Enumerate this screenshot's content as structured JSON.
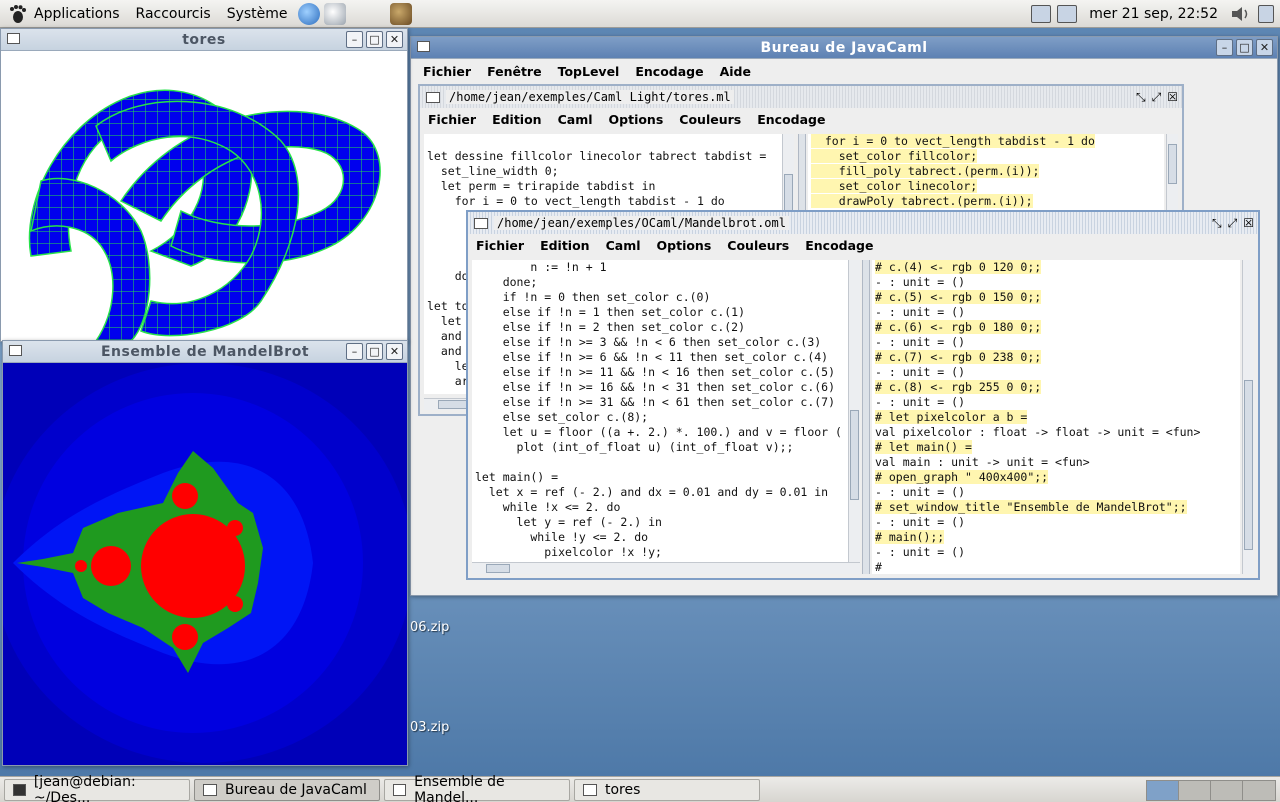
{
  "top_panel": {
    "applications": "Applications",
    "shortcuts": "Raccourcis",
    "system": "Système",
    "clock": "mer 21 sep, 22:52"
  },
  "desktop": {
    "files": [
      "06.zip",
      "03.zip"
    ]
  },
  "tores_window": {
    "title": "tores"
  },
  "mandelbrot_window": {
    "title": "Ensemble de MandelBrot"
  },
  "javacaml_window": {
    "title": "Bureau de JavaCaml",
    "menu": [
      "Fichier",
      "Fenêtre",
      "TopLevel",
      "Encodage",
      "Aide"
    ]
  },
  "tores_frame": {
    "path": "/home/jean/exemples/Caml Light/tores.ml",
    "menu": [
      "Fichier",
      "Edition",
      "Caml",
      "Options",
      "Couleurs",
      "Encodage"
    ],
    "code": [
      "",
      "let dessine fillcolor linecolor tabrect tabdist =",
      "  set_line_width 0;",
      "  let perm = trirapide tabdist in",
      "    for i = 0 to vect_length tabdist - 1 do",
      "",
      "",
      "",
      "",
      "    do",
      "",
      "let to",
      "  let",
      "  and",
      "  and",
      "    le",
      "    ar"
    ],
    "toplevel": [
      "  for i = 0 to vect_length tabdist - 1 do",
      "    set_color fillcolor;",
      "    fill_poly tabrect.(perm.(i));",
      "    set_color linecolor;",
      "    drawPoly tabrect.(perm.(i));"
    ]
  },
  "mandel_frame": {
    "path": "/home/jean/exemples/OCaml/Mandelbrot.oml",
    "menu": [
      "Fichier",
      "Edition",
      "Caml",
      "Options",
      "Couleurs",
      "Encodage"
    ],
    "code": [
      "        n := !n + 1",
      "    done;",
      "    if !n = 0 then set_color c.(0)",
      "    else if !n = 1 then set_color c.(1)",
      "    else if !n = 2 then set_color c.(2)",
      "    else if !n >= 3 && !n < 6 then set_color c.(3)",
      "    else if !n >= 6 && !n < 11 then set_color c.(4)",
      "    else if !n >= 11 && !n < 16 then set_color c.(5)",
      "    else if !n >= 16 && !n < 31 then set_color c.(6)",
      "    else if !n >= 31 && !n < 61 then set_color c.(7)",
      "    else set_color c.(8);",
      "    let u = floor ((a +. 2.) *. 100.) and v = floor (",
      "      plot (int_of_float u) (int_of_float v);;",
      "",
      "let main() =",
      "  let x = ref (- 2.) and dx = 0.01 and dy = 0.01 in",
      "    while !x <= 2. do",
      "      let y = ref (- 2.) in",
      "        while !y <= 2. do",
      "          pixelcolor !x !y;"
    ],
    "toplevel": [
      {
        "t": "# c.(4) <- rgb 0 120 0;;",
        "hl": true
      },
      {
        "t": "- : unit = ()",
        "hl": false
      },
      {
        "t": "# c.(5) <- rgb 0 150 0;;",
        "hl": true
      },
      {
        "t": "- : unit = ()",
        "hl": false
      },
      {
        "t": "# c.(6) <- rgb 0 180 0;;",
        "hl": true
      },
      {
        "t": "- : unit = ()",
        "hl": false
      },
      {
        "t": "# c.(7) <- rgb 0 238 0;;",
        "hl": true
      },
      {
        "t": "- : unit = ()",
        "hl": false
      },
      {
        "t": "# c.(8) <- rgb 255 0 0;;",
        "hl": true
      },
      {
        "t": "- : unit = ()",
        "hl": false
      },
      {
        "t": "# let pixelcolor a b =",
        "hl": true
      },
      {
        "t": "val pixelcolor : float -> float -> unit = <fun>",
        "hl": false
      },
      {
        "t": "# let main() =",
        "hl": true
      },
      {
        "t": "val main : unit -> unit = <fun>",
        "hl": false
      },
      {
        "t": "# open_graph \" 400x400\";;",
        "hl": true
      },
      {
        "t": "- : unit = ()",
        "hl": false
      },
      {
        "t": "# set_window_title \"Ensemble de MandelBrot\";;",
        "hl": true
      },
      {
        "t": "- : unit = ()",
        "hl": false
      },
      {
        "t": "# main();;",
        "hl": true
      },
      {
        "t": "- : unit = ()",
        "hl": false
      },
      {
        "t": "#",
        "hl": false
      }
    ]
  },
  "taskbar": {
    "tasks": [
      "[jean@debian: ~/Des...",
      "Bureau de JavaCaml",
      "Ensemble de Mandel...",
      "tores"
    ]
  },
  "colors": {
    "mandel_red": "#ff0000",
    "mandel_green": "#1f9a1f",
    "torus_blue": "#0000ee",
    "torus_mesh": "#27e14a",
    "highlight": "#fff6b0"
  }
}
